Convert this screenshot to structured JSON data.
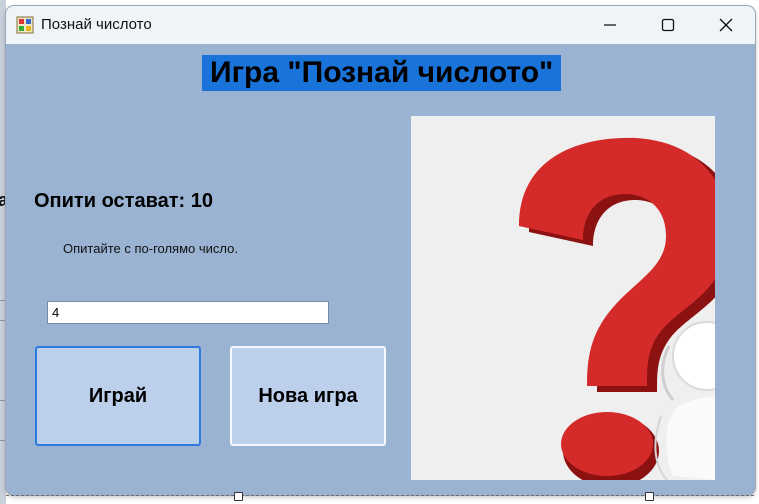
{
  "window": {
    "title": "Познай числото"
  },
  "controls": {
    "minimize": "minimize-icon",
    "maximize": "maximize-icon",
    "close": "close-icon"
  },
  "game": {
    "heading": "Игра \"Познай числото\"",
    "attempts": "Опити остават: 10",
    "hint": "Опитайте с по-голямо число.",
    "input_value": "4",
    "play_label": "Играй",
    "new_game_label": "Нова игра"
  },
  "designer": {
    "cut_letter": "a"
  },
  "picture": {
    "icon": "question-mark-icon"
  },
  "colors": {
    "form_bg": "#9ab3d2",
    "heading_bg": "#1a73d9",
    "button_bg": "#bcd0ec",
    "question_red": "#d42a2a"
  }
}
